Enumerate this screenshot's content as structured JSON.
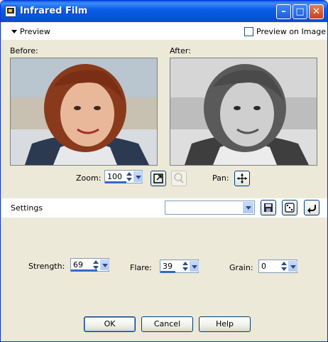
{
  "window": {
    "title": "Infrared Film",
    "controls": {
      "minimize": "–",
      "maximize": "□",
      "close": "✕"
    }
  },
  "preview": {
    "toggle_label": "Preview",
    "on_image_label": "Preview on Image",
    "on_image_checked": false
  },
  "images": {
    "before_label": "Before:",
    "after_label": "After:"
  },
  "zoom": {
    "label": "Zoom:",
    "value": "100",
    "pan_label": "Pan:"
  },
  "settings": {
    "label": "Settings",
    "preset_value": ""
  },
  "params": {
    "strength": {
      "label": "Strength:",
      "value": "69",
      "fill": 0.69
    },
    "flare": {
      "label": "Flare:",
      "value": "39",
      "fill": 0.39
    },
    "grain": {
      "label": "Grain:",
      "value": "0",
      "fill": 0.0
    }
  },
  "buttons": {
    "ok": "OK",
    "cancel": "Cancel",
    "help": "Help"
  },
  "colors": {
    "title_bar": "#0a5fe8",
    "dialog_bg": "#ece9d8",
    "accent": "#316ac5"
  }
}
